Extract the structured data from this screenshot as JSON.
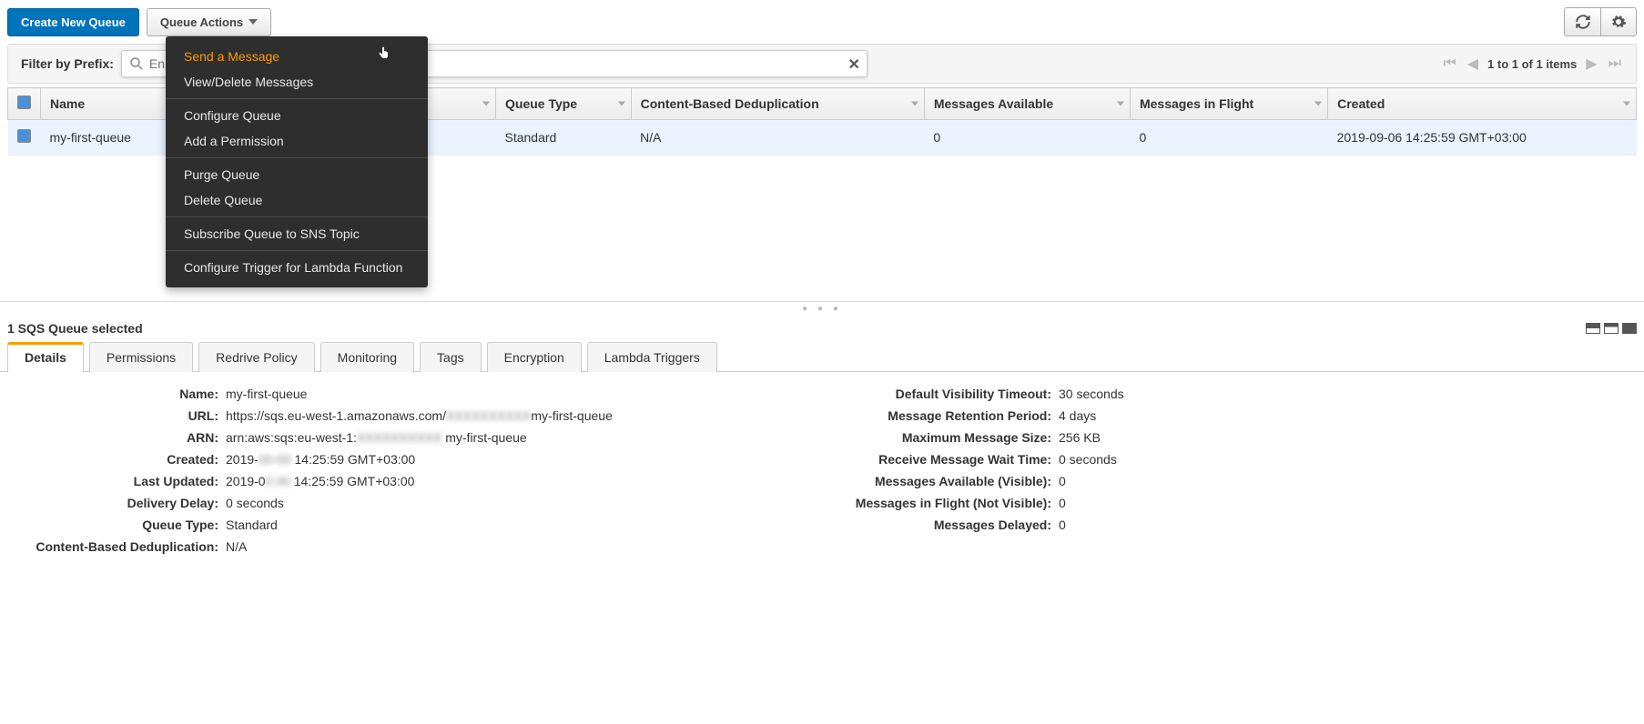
{
  "toolbar": {
    "create_button": "Create New Queue",
    "actions_button": "Queue Actions"
  },
  "dropdown": {
    "groups": [
      {
        "items": [
          "Send a Message",
          "View/Delete Messages"
        ],
        "highlighted_index": 0
      },
      {
        "items": [
          "Configure Queue",
          "Add a Permission"
        ]
      },
      {
        "items": [
          "Purge Queue",
          "Delete Queue"
        ]
      },
      {
        "items": [
          "Subscribe Queue to SNS Topic"
        ]
      },
      {
        "items": [
          "Configure Trigger for Lambda Function"
        ]
      }
    ]
  },
  "filter": {
    "label": "Filter by Prefix:",
    "placeholder": "En"
  },
  "pagination": {
    "text": "1 to 1 of 1 items"
  },
  "table": {
    "columns": [
      "Name",
      "Queue Type",
      "Content-Based Deduplication",
      "Messages Available",
      "Messages in Flight",
      "Created"
    ],
    "row": {
      "name": "my-first-queue",
      "queue_type": "Standard",
      "dedup": "N/A",
      "available": "0",
      "in_flight": "0",
      "created": "2019-09-06 14:25:59 GMT+03:00"
    }
  },
  "selection_text": "1 SQS Queue selected",
  "tabs": [
    "Details",
    "Permissions",
    "Redrive Policy",
    "Monitoring",
    "Tags",
    "Encryption",
    "Lambda Triggers"
  ],
  "details_left": {
    "name_k": "Name:",
    "name_v": "my-first-queue",
    "url_k": "URL:",
    "url_v_pre": "https://sqs.eu-west-1.amazonaws.com/",
    "url_v_blur": "XXXXXXXXXX",
    "url_v_post": "my-first-queue",
    "arn_k": "ARN:",
    "arn_v_pre": "arn:aws:sqs:eu-west-1:",
    "arn_v_blur": "XXXXXXXXXX",
    "arn_v_post": " my-first-queue",
    "created_k": "Created:",
    "created_v_pre": "2019-",
    "created_v_blur": "00-00",
    "created_v_post": " 14:25:59 GMT+03:00",
    "updated_k": "Last Updated:",
    "updated_v_pre": "2019-0",
    "updated_v_blur": "0 00",
    "updated_v_post": " 14:25:59 GMT+03:00",
    "delay_k": "Delivery Delay:",
    "delay_v": "0 seconds",
    "qtype_k": "Queue Type:",
    "qtype_v": "Standard",
    "dedup_k": "Content-Based Deduplication:",
    "dedup_v": "N/A"
  },
  "details_right": {
    "visibility_k": "Default Visibility Timeout:",
    "visibility_v": "30 seconds",
    "retention_k": "Message Retention Period:",
    "retention_v": "4 days",
    "maxsize_k": "Maximum Message Size:",
    "maxsize_v": "256 KB",
    "wait_k": "Receive Message Wait Time:",
    "wait_v": "0 seconds",
    "avail_k": "Messages Available (Visible):",
    "avail_v": "0",
    "flight_k": "Messages in Flight (Not Visible):",
    "flight_v": "0",
    "delayed_k": "Messages Delayed:",
    "delayed_v": "0"
  }
}
